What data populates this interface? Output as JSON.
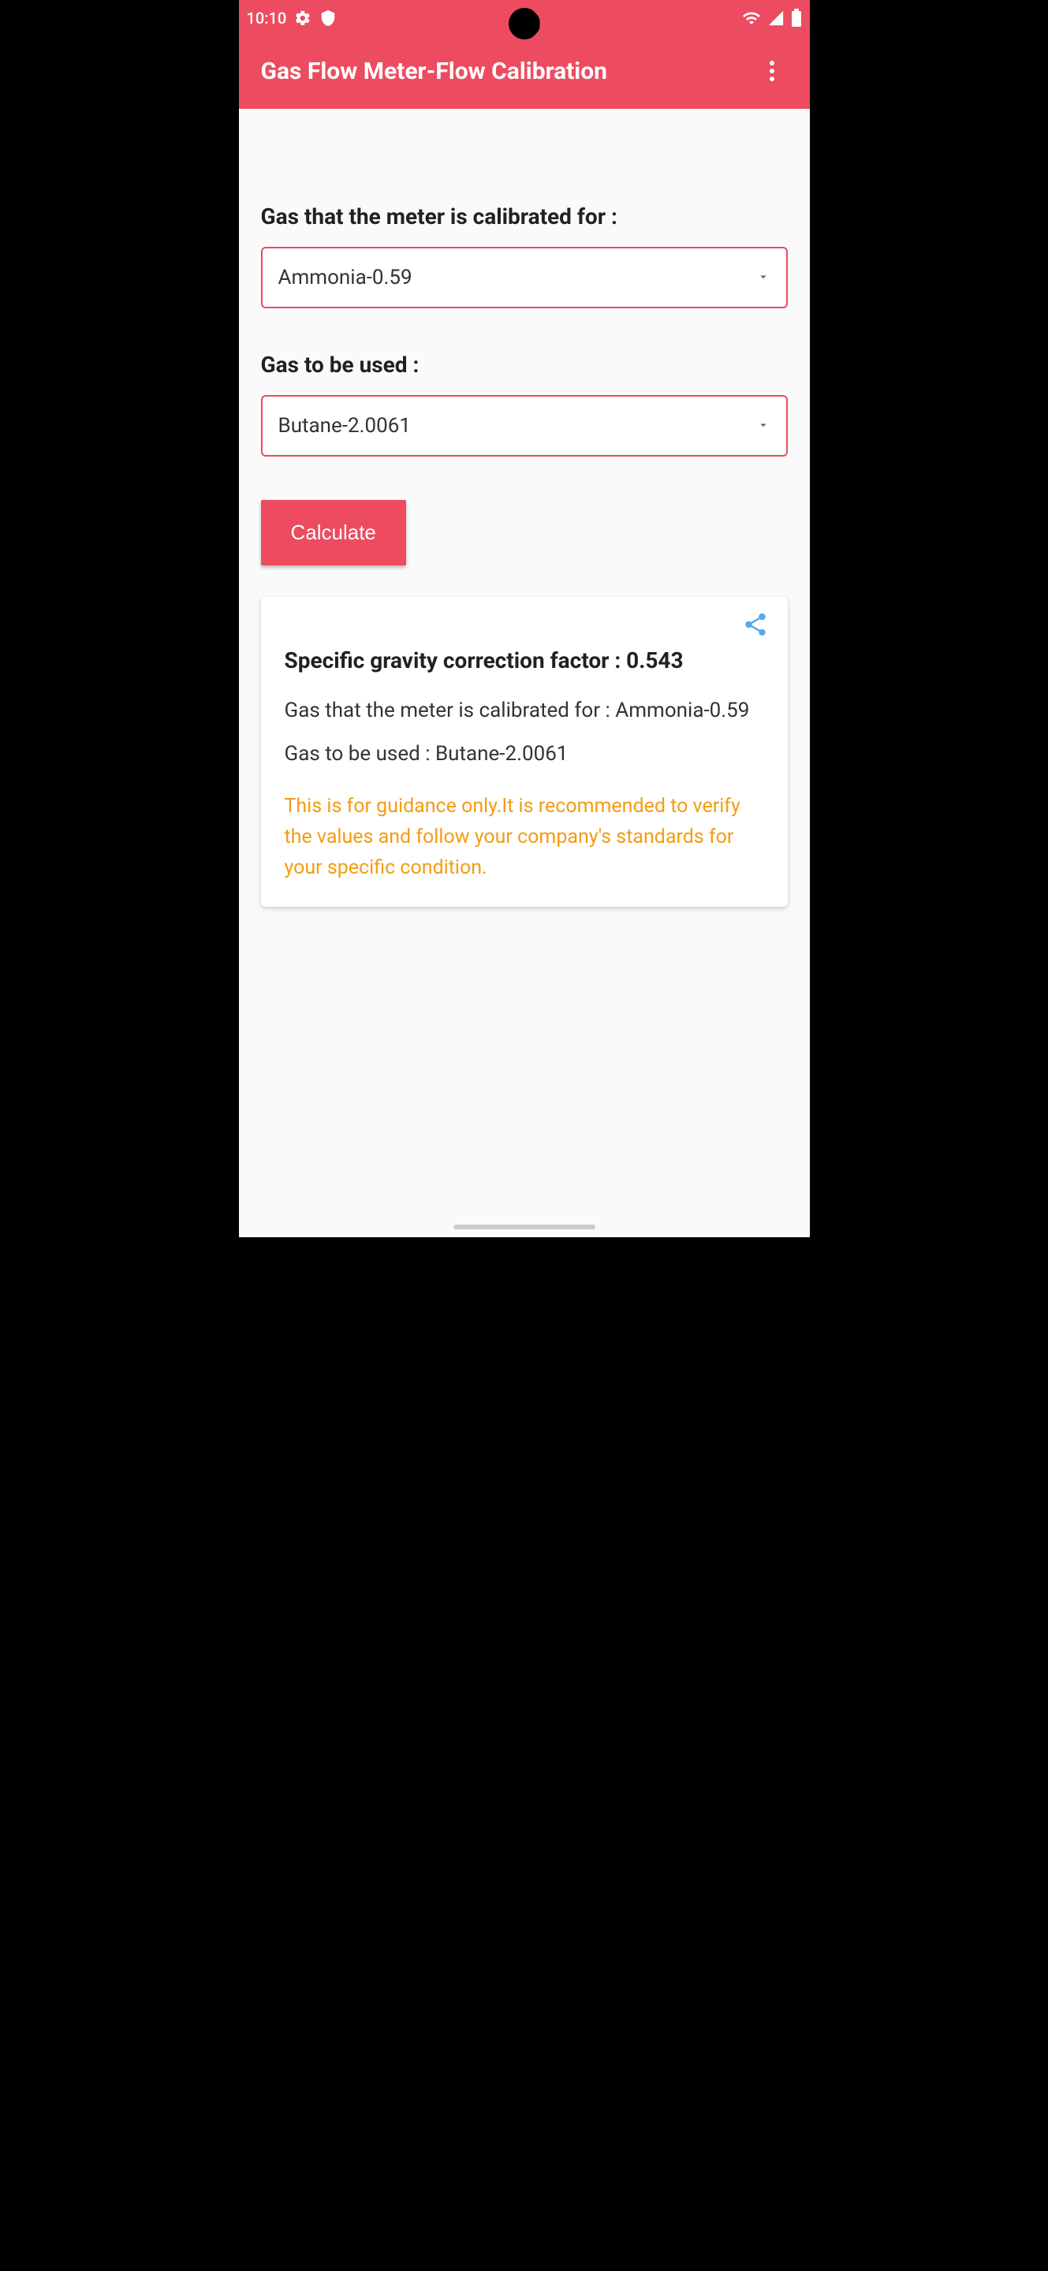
{
  "status": {
    "time": "10:10",
    "gear_icon": "gear-icon",
    "shield_icon": "shield-icon",
    "wifi_icon": "wifi-icon",
    "signal_icon": "signal-icon",
    "battery_icon": "battery-icon"
  },
  "appbar": {
    "title": "Gas Flow Meter-Flow Calibration"
  },
  "form": {
    "calibrated_label": "Gas that the meter is calibrated for :",
    "calibrated_value": "Ammonia-0.59",
    "used_label": "Gas to be used :",
    "used_value": "Butane-2.0061",
    "calculate_button": "Calculate"
  },
  "result": {
    "factor_line": "Specific gravity correction factor : 0.543",
    "calibrated_line": "Gas that the meter is calibrated for : Ammonia-0.59",
    "used_line": "Gas to be used : Butane-2.0061",
    "guidance": "This is for guidance only.It is recommended to verify the values and follow your company's standards for your specific condition."
  }
}
